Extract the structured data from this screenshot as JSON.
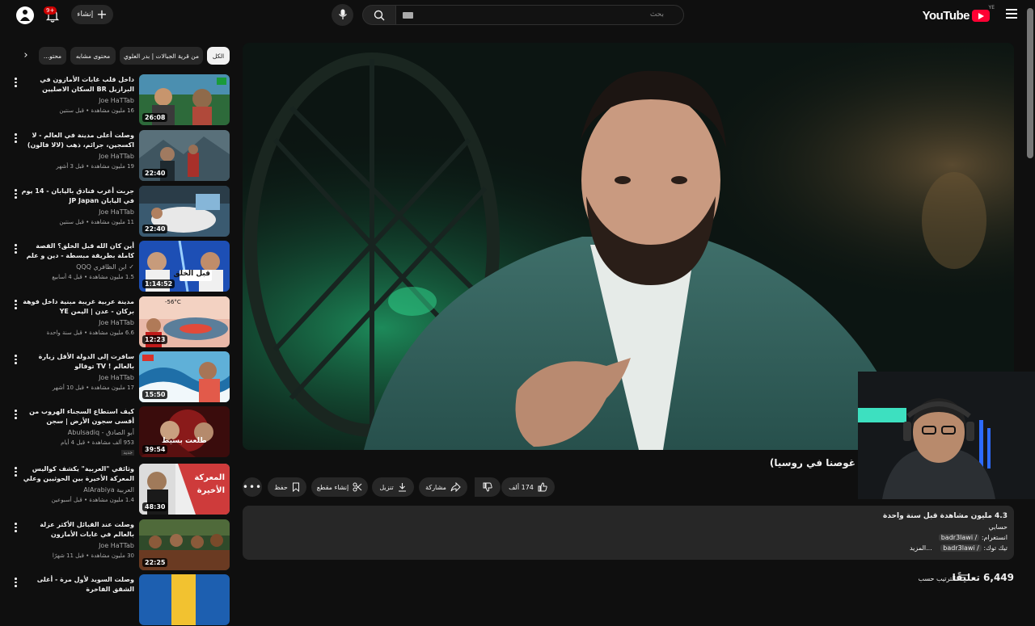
{
  "header": {
    "logo_text": "YouTube",
    "country_code": "YE",
    "search_placeholder": "بحث",
    "create_label": "إنشاء",
    "notification_count": "9+"
  },
  "video": {
    "title": "غوصنا في روسيا)",
    "actions": {
      "likes": "174 ألف",
      "share": "مشاركة",
      "download": "تنزيل",
      "clip": "إنشاء مقطع",
      "save": "حفظ"
    },
    "description": {
      "stats": "4.3 مليون مشاهدة قبل سنة واحدة",
      "line2": "حسابي",
      "line3_label": "انستغرام:",
      "line3_handle": "/ badr3lawi",
      "line4_label": "تيك توك:",
      "line4_handle": "/ badr3lawi",
      "more": "...المزيد"
    },
    "comments_count": "6,449 تعليقًا",
    "sort_label": "الترتيب حسب"
  },
  "filters": [
    {
      "label": "الكل",
      "active": true
    },
    {
      "label": "من قرية الجبالات | بدر العلوي",
      "active": false
    },
    {
      "label": "محتوى مشابه",
      "active": false
    },
    {
      "label": "محتو...",
      "active": false
    }
  ],
  "colors": {
    "accent": "#ff0033",
    "bg": "#0f0f0f",
    "surface": "#272727"
  },
  "related": [
    {
      "title": "داخل قلب غابات الأمازون في البرازيل BR السكان الاصليين",
      "channel": "Joe HaTTab",
      "meta": "16 مليون مشاهدة • قبل سنتين",
      "duration": "26:08",
      "new": ""
    },
    {
      "title": "وصلت أعلى مدينة في العالم - لا اكسجين، جرائم، ذهب (لالا فالون) PE",
      "channel": "Joe HaTTab",
      "meta": "19 مليون مشاهدة • قبل 3 أشهر",
      "duration": "22:40",
      "new": ""
    },
    {
      "title": "جربت أغرب فنادق باليابان - 14 يوم في اليابان JP Japan",
      "channel": "Joe HaTTab",
      "meta": "11 مليون مشاهدة • قبل سنتين",
      "duration": "22:40",
      "new": ""
    },
    {
      "title": "أين كان الله قبل الخلق؟ القصة كاملة بطريقة مبسطة - دين و علم",
      "channel": "ابن الظافري QQQ",
      "meta": "1.5 مليون مشاهدة • قبل 4 أسابيع",
      "duration": "1:14:52",
      "new": ""
    },
    {
      "title": "مدينة عربية غريبة مبنية داخل فوهة بركان - عدن | اليمن YE",
      "channel": "Joe HaTTab",
      "meta": "6.6 مليون مشاهدة • قبل سنة واحدة",
      "duration": "12:23",
      "new": ""
    },
    {
      "title": "سافرت إلى الدولة الأقل زيارة بالعالم ! TV توفالو",
      "channel": "Joe HaTTab",
      "meta": "17 مليون مشاهدة • قبل 10 أشهر",
      "duration": "15:50",
      "new": ""
    },
    {
      "title": "كيف استطاع السجناء الهروب من أقسى سجون الأرض | سجن كلينتون من فيلم إلى حقيقة",
      "channel": "أبو الصادق - Abulsadiq",
      "meta": "953 ألف مشاهدة • قبل 4 أيام",
      "duration": "39:54",
      "new": "جديد"
    },
    {
      "title": "وثائقي \"العربية\" يكشف كواليس المعركة الأخيرة بين الحوثيين وعلي عبد الله صالح",
      "channel": "العربية AlArabiya",
      "meta": "1.4 مليون مشاهدة • قبل أسبوعين",
      "duration": "48:30",
      "new": ""
    },
    {
      "title": "وصلت عند القبائل الأكثر عزلة بالعالم في غابات الأمازون Waorani Tribe |",
      "channel": "Joe HaTTab",
      "meta": "30 مليون مشاهدة • قبل 11 شهرًا",
      "duration": "22:25",
      "new": ""
    },
    {
      "title": "وصلت السويد لأول مرة - أغلى الشقق الفاخرة",
      "channel": "",
      "meta": "",
      "duration": "",
      "new": ""
    }
  ],
  "thumb_texts": {
    "t4": "قبل الخلق",
    "t5": "-56°C",
    "t7": "طلعت بسيط",
    "t8a": "المعركة",
    "t8b": "الأخيرة"
  }
}
